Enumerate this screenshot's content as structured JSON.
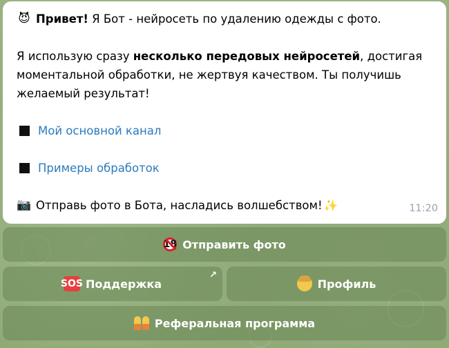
{
  "message": {
    "intro_emoji": "😈",
    "intro_bold": "Привет!",
    "intro_rest": " Я Бот - нейросеть по удалению одежды с фото.",
    "p2_line1_pre": "Я использую сразу ",
    "p2_line1_bold": "несколько передовых нейросетей",
    "p2_line1_post": ", достигая",
    "p2_line2": "моментальной обработки, не жертвуя качеством. Ты получишь",
    "p2_line3": "желаемый результат!",
    "link1": "Мой основной канал",
    "link2": "Примеры обработок",
    "final_emoji": "📷",
    "final_text": "Отправь фото в Бота, насладись волшебством!",
    "final_sparkle": "✨",
    "time": "11:20"
  },
  "keyboard": {
    "send_photo": "Отправить фото",
    "support": "Поддержка",
    "profile": "Профиль",
    "referral": "Реферальная программа"
  },
  "icons": {
    "send_photo": "no-under-18-icon",
    "support": "sos-icon",
    "profile": "person-icon",
    "referral": "two-people-icon",
    "support_link": "arrow-up-right-icon"
  },
  "colors": {
    "link": "#2b7bbd",
    "bubble": "#ffffff",
    "button": "#6a8656"
  }
}
